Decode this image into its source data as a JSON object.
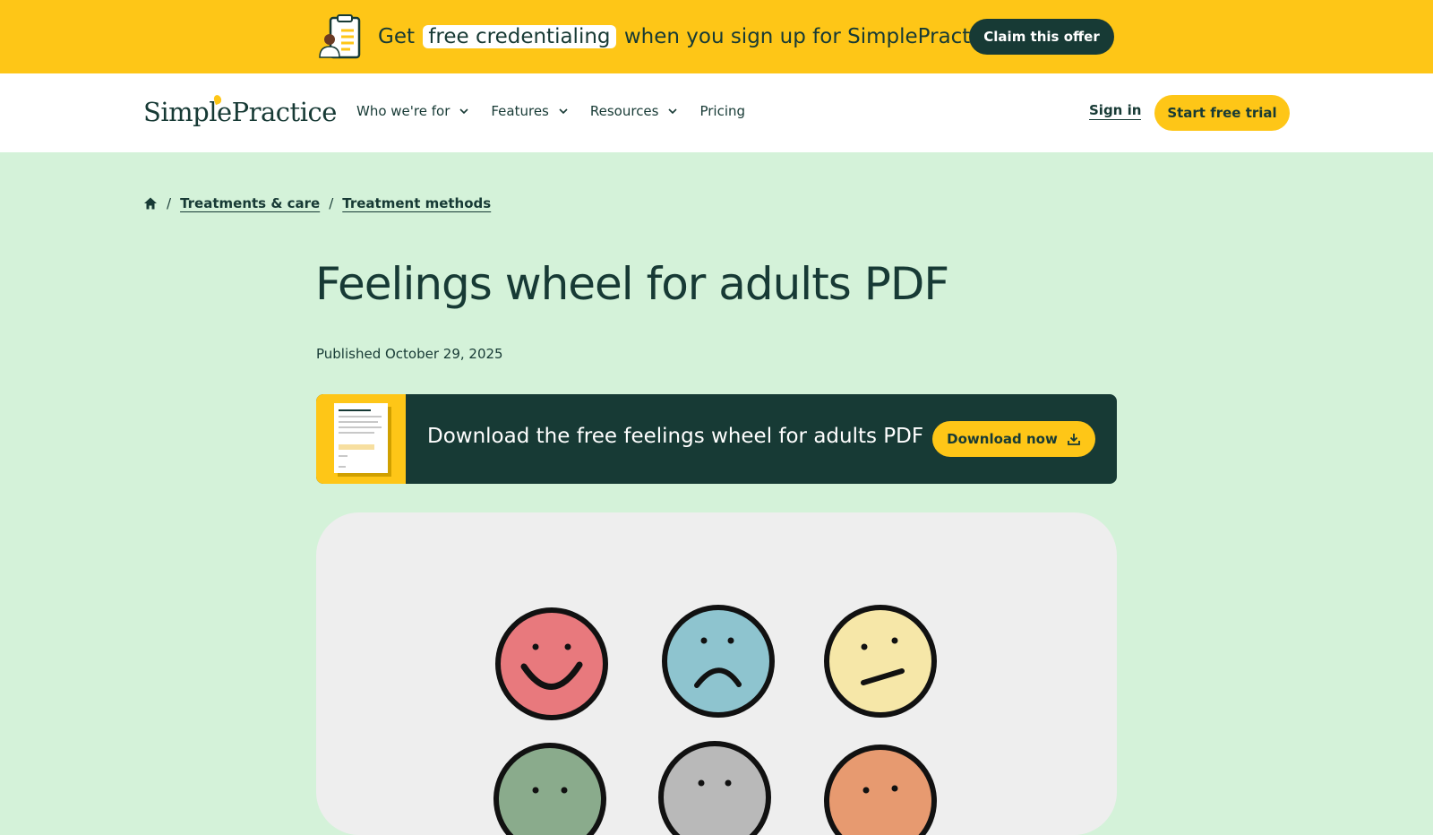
{
  "promo": {
    "text_before": "Get",
    "highlight": "free credentialing",
    "text_after": "when you sign up for SimplePractice",
    "cta_label": "Claim this offer",
    "icon": "clipboard-person-icon"
  },
  "header": {
    "logo": "SimplePractice",
    "nav": [
      {
        "label": "Who we're for",
        "has_dropdown": true
      },
      {
        "label": "Features",
        "has_dropdown": true
      },
      {
        "label": "Resources",
        "has_dropdown": true
      },
      {
        "label": "Pricing",
        "has_dropdown": false
      }
    ],
    "sign_in": "Sign in",
    "trial_label": "Start free trial"
  },
  "breadcrumb": {
    "home_icon": "home-icon",
    "separator": "/",
    "items": [
      "Treatments & care",
      "Treatment methods"
    ]
  },
  "page": {
    "title": "Feelings wheel for adults PDF",
    "published": "Published October 29, 2025"
  },
  "download": {
    "text": "Download the free feelings wheel for adults PDF",
    "button_label": "Download now",
    "button_icon": "download-icon"
  },
  "colors": {
    "banner": "#fec617",
    "dark": "#173a35",
    "page_bg": "#d4f2d9",
    "card_bg": "#eeeeee"
  },
  "illustration": {
    "faces": [
      "happy-face-icon",
      "sad-face-icon",
      "skeptical-face-icon",
      "green-face-icon",
      "gray-face-icon",
      "orange-face-icon"
    ]
  }
}
